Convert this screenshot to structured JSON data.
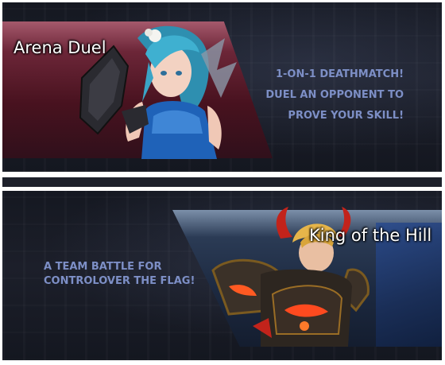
{
  "modes": [
    {
      "title": "Arena Duel",
      "description": [
        "1-ON-1 DEATHMATCH!",
        "DUEL AN OPPONENT TO",
        "PROVE YOUR SKILL!"
      ],
      "banner_color": "#6c2638"
    },
    {
      "title": "King of the Hill",
      "description": [
        "A TEAM BATTLE FOR",
        "CONTROLOVER THE FLAG!"
      ],
      "banner_color": "#2b3b55"
    }
  ],
  "text_color": "#7d8fc6"
}
